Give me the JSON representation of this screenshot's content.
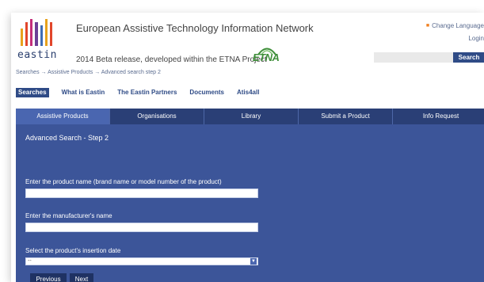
{
  "header": {
    "logo_text": "eastin",
    "logo_colors": [
      "#e8a21c",
      "#e1462b",
      "#c42d7a",
      "#6c3f96",
      "#3f6db5",
      "#e8a21c",
      "#e1462b"
    ],
    "title": "European Assistive Technology Information Network",
    "subtitle": "2014 Beta release, developed within the ETNA Project",
    "etna_logo_text": "ETNA",
    "change_language": "Change Language",
    "login": "Login",
    "search_button": "Search",
    "search_value": ""
  },
  "breadcrumb": "Searches → Assistive Products → Advanced search step 2",
  "topnav": {
    "items": [
      "Searches",
      "What is Eastin",
      "The Eastin Partners",
      "Documents",
      "Atis4all"
    ]
  },
  "tabs": {
    "items": [
      "Assistive Products",
      "Organisations",
      "Library",
      "Submit a Product",
      "Info Request"
    ]
  },
  "form": {
    "title": "Advanced Search - Step 2",
    "product_label": "Enter the product name (brand name or model number of the product)",
    "product_value": "",
    "manufacturer_label": "Enter the manufacturer's name",
    "manufacturer_value": "",
    "date_label": "Select the product's insertion date",
    "date_selected": "--",
    "previous_button": "Previous",
    "next_button": "Next"
  },
  "colors": {
    "panel": "#3c5599",
    "tab_bar": "#2a3f76",
    "accent": "#2f4b86",
    "etna_green": "#3f8f3a"
  }
}
